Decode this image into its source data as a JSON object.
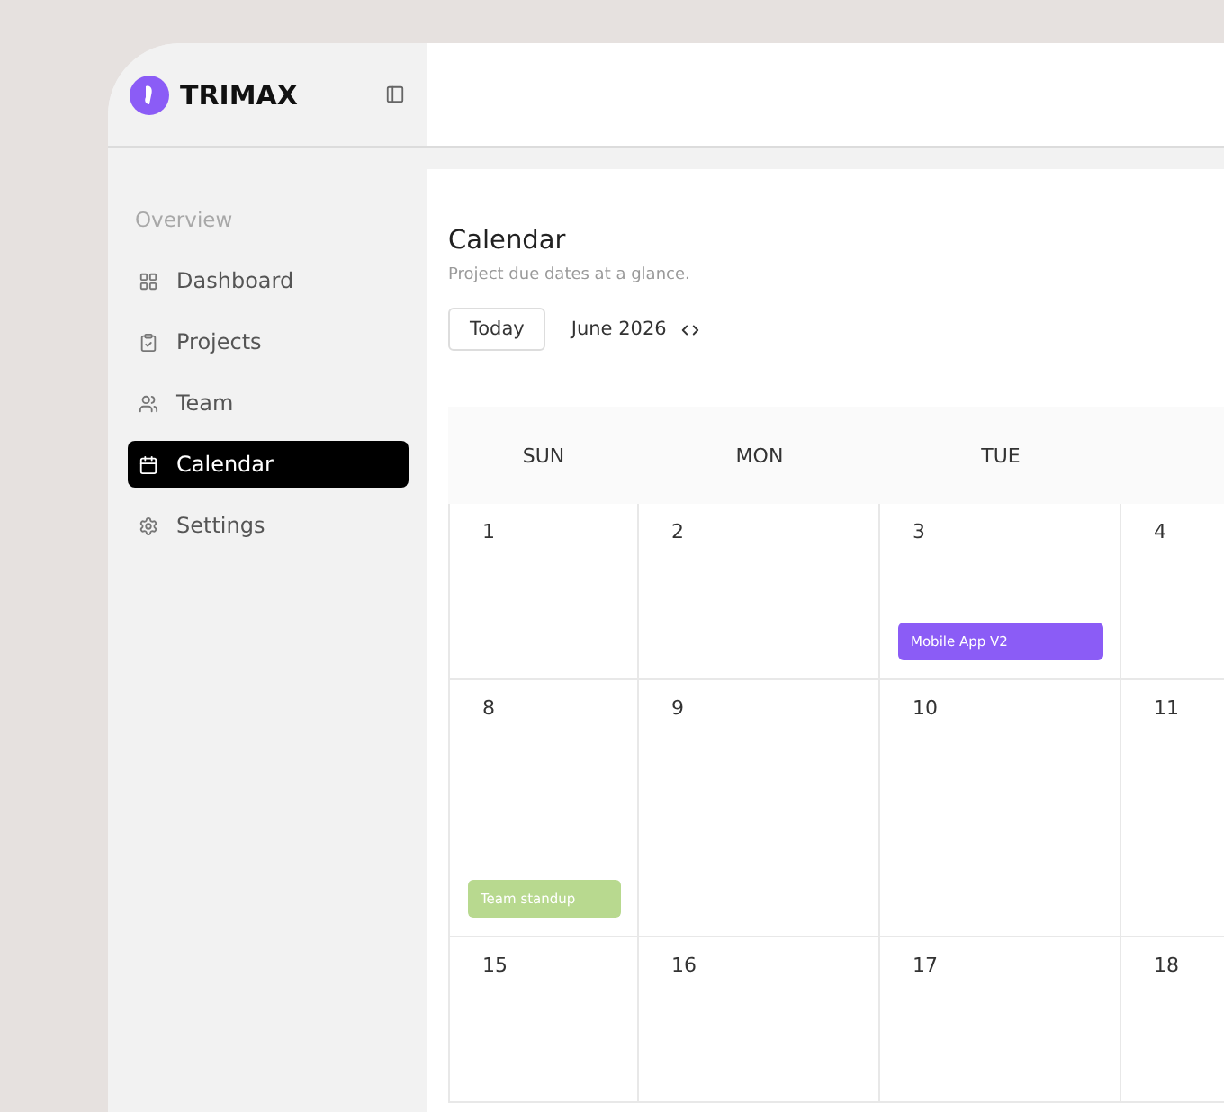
{
  "brand": {
    "name": "TRIMAX"
  },
  "sidebar": {
    "section_label": "Overview",
    "items": [
      {
        "label": "Dashboard",
        "selected": false
      },
      {
        "label": "Projects",
        "selected": false
      },
      {
        "label": "Team",
        "selected": false
      },
      {
        "label": "Calendar",
        "selected": true
      },
      {
        "label": "Settings",
        "selected": false
      }
    ]
  },
  "page": {
    "title": "Calendar",
    "subtitle": "Project due dates at a glance.",
    "today_button": "Today",
    "month": "June 2026"
  },
  "calendar": {
    "weekdays": [
      "SUN",
      "MON",
      "TUE"
    ],
    "weeks": [
      {
        "days": [
          {
            "number": "1"
          },
          {
            "number": "2"
          },
          {
            "number": "3",
            "events": [
              {
                "title": "Mobile App V2",
                "color": "#8b5cf6"
              }
            ]
          },
          {
            "number": "4"
          }
        ]
      },
      {
        "days": [
          {
            "number": "8",
            "events": [
              {
                "title": "Team standup",
                "color": "#b8d98f"
              }
            ]
          },
          {
            "number": "9"
          },
          {
            "number": "10"
          },
          {
            "number": "11"
          }
        ]
      },
      {
        "days": [
          {
            "number": "15"
          },
          {
            "number": "16"
          },
          {
            "number": "17"
          },
          {
            "number": "18"
          }
        ]
      }
    ]
  }
}
